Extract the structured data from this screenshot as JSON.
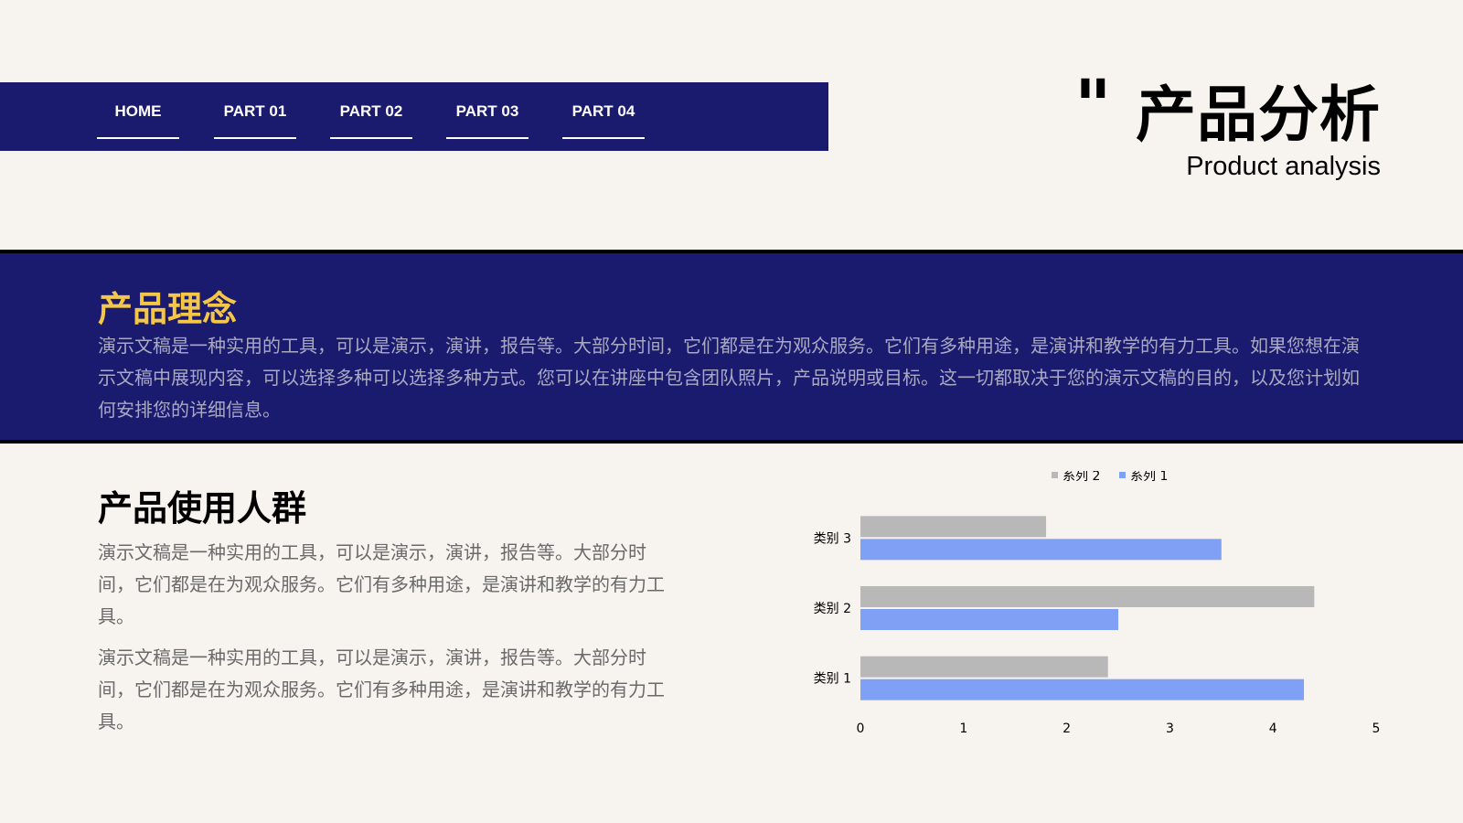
{
  "nav": {
    "items": [
      {
        "label": "HOME"
      },
      {
        "label": "PART 01"
      },
      {
        "label": "PART 02"
      },
      {
        "label": "PART 03"
      },
      {
        "label": "PART 04"
      }
    ]
  },
  "header": {
    "quote_mark": "\"",
    "title": "产品分析",
    "subtitle": "Product analysis"
  },
  "concept": {
    "title": "产品理念",
    "text": "演示文稿是一种实用的工具，可以是演示，演讲，报告等。大部分时间，它们都是在为观众服务。它们有多种用途，是演讲和教学的有力工具。如果您想在演示文稿中展现内容，可以选择多种可以选择多种方式。您可以在讲座中包含团队照片，产品说明或目标。这一切都取决于您的演示文稿的目的，以及您计划如何安排您的详细信息。"
  },
  "users": {
    "title": "产品使用人群",
    "para1": "演示文稿是一种实用的工具，可以是演示，演讲，报告等。大部分时间，它们都是在为观众服务。它们有多种用途，是演讲和教学的有力工具。",
    "para2": "演示文稿是一种实用的工具，可以是演示，演讲，报告等。大部分时间，它们都是在为观众服务。它们有多种用途，是演讲和教学的有力工具。"
  },
  "chart_data": {
    "type": "bar",
    "orientation": "horizontal",
    "categories": [
      "类别 1",
      "类别 2",
      "类别 3"
    ],
    "series": [
      {
        "name": "系列 1",
        "values": [
          4.3,
          2.5,
          3.5
        ],
        "color": "#7fa0f5"
      },
      {
        "name": "系列 2",
        "values": [
          2.4,
          4.4,
          1.8
        ],
        "color": "#b8b8b8"
      }
    ],
    "legend_order": [
      "系列 2",
      "系列 1"
    ],
    "xlim": [
      0,
      5
    ],
    "xticks": [
      "0",
      "1",
      "2",
      "3",
      "4",
      "5"
    ],
    "legend_position": "top",
    "grid": false
  }
}
